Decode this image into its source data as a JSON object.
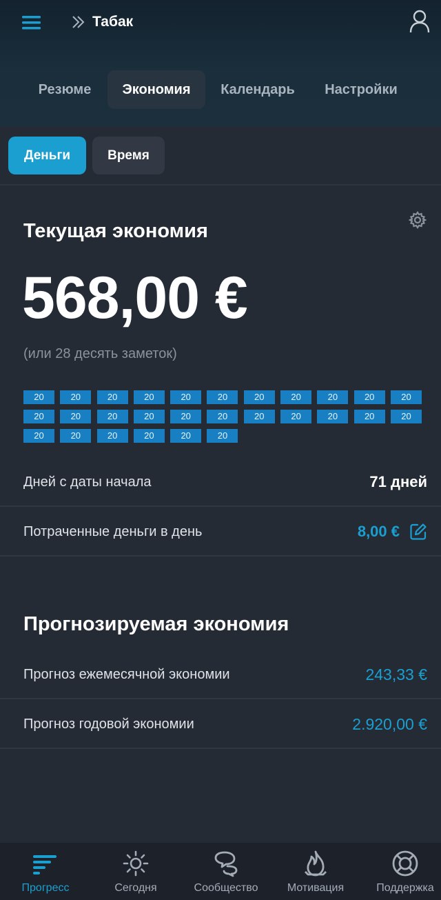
{
  "colors": {
    "accent": "#1b9fd0",
    "background": "#252b35",
    "header": "#1a2e3b",
    "note_chip": "#1880c2",
    "muted_text": "#8a929c"
  },
  "header": {
    "menu_icon": "hamburger-menu-icon",
    "breadcrumb_icon": "double-chevron-right-icon",
    "title": "Табак",
    "profile_icon": "user-profile-icon"
  },
  "main_tabs": [
    {
      "label": "Резюме",
      "active": false
    },
    {
      "label": "Экономия",
      "active": true
    },
    {
      "label": "Календарь",
      "active": false
    },
    {
      "label": "Настройки",
      "active": false
    }
  ],
  "sub_tabs": [
    {
      "label": "Деньги",
      "active": true
    },
    {
      "label": "Время",
      "active": false
    }
  ],
  "current_savings": {
    "title": "Текущая экономия",
    "settings_icon": "gear-icon",
    "amount": "568,00 €",
    "notes_caption": "(или 28 десять заметок)",
    "note_value": "20",
    "note_count": 28,
    "rows": {
      "days": {
        "label": "Дней с даты начала",
        "value": "71 дней"
      },
      "daily": {
        "label": "Потраченные деньги в день",
        "value": "8,00 €",
        "edit_icon": "edit-pencil-icon"
      }
    }
  },
  "forecast": {
    "title": "Прогнозируемая экономия",
    "monthly": {
      "label": "Прогноз ежемесячной экономии",
      "value": "243,33 €"
    },
    "yearly": {
      "label": "Прогноз годовой экономии",
      "value": "2.920,00 €"
    }
  },
  "bottom_nav": [
    {
      "label": "Прогресс",
      "icon": "progress-bars-icon",
      "active": true
    },
    {
      "label": "Сегодня",
      "icon": "sun-icon",
      "active": false
    },
    {
      "label": "Сообщество",
      "icon": "chat-bubbles-icon",
      "active": false
    },
    {
      "label": "Мотивация",
      "icon": "flame-icon",
      "active": false
    },
    {
      "label": "Поддержка",
      "icon": "lifebuoy-icon",
      "active": false
    }
  ]
}
